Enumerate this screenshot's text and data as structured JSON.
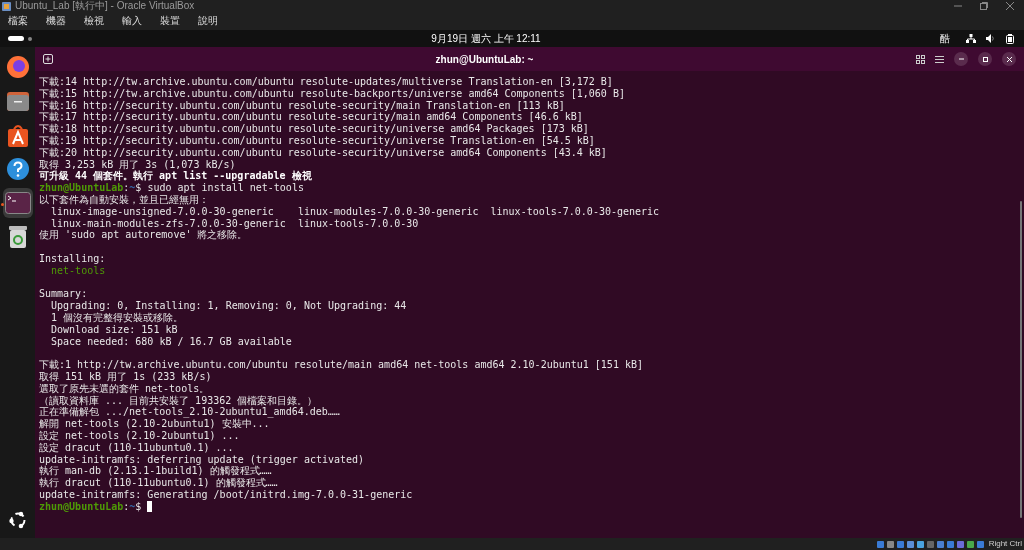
{
  "host_window": {
    "title": "Ubuntu_Lab [執行中] - Oracle VirtualBox"
  },
  "host_menu": [
    "檔案",
    "機器",
    "檢視",
    "輸入",
    "裝置",
    "說明"
  ],
  "top_bar": {
    "clock": "9月19日 週六 上午 12:11",
    "input_method": "酷"
  },
  "dock": {
    "apps": [
      {
        "kind": "browser",
        "selected": false
      },
      {
        "kind": "files",
        "selected": false
      },
      {
        "kind": "store",
        "selected": false
      },
      {
        "kind": "help",
        "selected": false
      },
      {
        "kind": "terminal",
        "selected": true
      },
      {
        "kind": "trash",
        "selected": false
      }
    ]
  },
  "terminal": {
    "title": "zhun@UbuntuLab: ~",
    "lines": [
      {
        "kind": "plain",
        "text": "下載:14 http://tw.archive.ubuntu.com/ubuntu resolute-updates/multiverse Translation-en [3,172 B]"
      },
      {
        "kind": "plain",
        "text": "下載:15 http://tw.archive.ubuntu.com/ubuntu resolute-backports/universe amd64 Components [1,060 B]"
      },
      {
        "kind": "plain",
        "text": "下載:16 http://security.ubuntu.com/ubuntu resolute-security/main Translation-en [113 kB]"
      },
      {
        "kind": "plain",
        "text": "下載:17 http://security.ubuntu.com/ubuntu resolute-security/main amd64 Components [46.6 kB]"
      },
      {
        "kind": "plain",
        "text": "下載:18 http://security.ubuntu.com/ubuntu resolute-security/universe amd64 Packages [173 kB]"
      },
      {
        "kind": "plain",
        "text": "下載:19 http://security.ubuntu.com/ubuntu resolute-security/universe Translation-en [54.5 kB]"
      },
      {
        "kind": "plain",
        "text": "下載:20 http://security.ubuntu.com/ubuntu resolute-security/universe amd64 Components [43.4 kB]"
      },
      {
        "kind": "plain",
        "text": "取得 3,253 kB 用了 3s (1,073 kB/s)"
      },
      {
        "kind": "bold",
        "text": "可升級 44 個套件。執行 apt list --upgradable 檢視"
      },
      {
        "kind": "prompt",
        "user": "zhun@UbuntuLab",
        "colon": ":",
        "path": "~",
        "command": "$ sudo apt install net-tools",
        "cursor": false
      },
      {
        "kind": "plain",
        "text": "以下套件為自動安裝，並且已經無用："
      },
      {
        "kind": "plain",
        "text": "  linux-image-unsigned-7.0.0-30-generic    linux-modules-7.0.0-30-generic  linux-tools-7.0.0-30-generic"
      },
      {
        "kind": "plain",
        "text": "  linux-main-modules-zfs-7.0.0-30-generic  linux-tools-7.0.0-30"
      },
      {
        "kind": "plain",
        "text": "使用 'sudo apt autoremove' 將之移除。"
      },
      {
        "kind": "blank"
      },
      {
        "kind": "plain",
        "text": "Installing:"
      },
      {
        "kind": "package",
        "text": "  net-tools"
      },
      {
        "kind": "blank"
      },
      {
        "kind": "plain",
        "text": "Summary:"
      },
      {
        "kind": "plain",
        "text": "  Upgrading: 0, Installing: 1, Removing: 0, Not Upgrading: 44"
      },
      {
        "kind": "plain",
        "text": "  1 個沒有完整得安裝或移除。"
      },
      {
        "kind": "plain",
        "text": "  Download size: 151 kB"
      },
      {
        "kind": "plain",
        "text": "  Space needed: 680 kB / 16.7 GB available"
      },
      {
        "kind": "blank"
      },
      {
        "kind": "plain",
        "text": "下載:1 http://tw.archive.ubuntu.com/ubuntu resolute/main amd64 net-tools amd64 2.10-2ubuntu1 [151 kB]"
      },
      {
        "kind": "plain",
        "text": "取得 151 kB 用了 1s (233 kB/s)"
      },
      {
        "kind": "plain",
        "text": "選取了原先未選的套件 net-tools。"
      },
      {
        "kind": "plain",
        "text": "（讀取資料庫 ... 目前共安裝了 193362 個檔案和目錄。）"
      },
      {
        "kind": "plain",
        "text": "正在準備解包 .../net-tools_2.10-2ubuntu1_amd64.deb……"
      },
      {
        "kind": "plain",
        "text": "解開 net-tools (2.10-2ubuntu1) 安裝中..."
      },
      {
        "kind": "plain",
        "text": "設定 net-tools (2.10-2ubuntu1) ..."
      },
      {
        "kind": "plain",
        "text": "設定 dracut (110-11ubuntu0.1) ..."
      },
      {
        "kind": "plain",
        "text": "update-initramfs: deferring update (trigger activated)"
      },
      {
        "kind": "plain",
        "text": "執行 man-db (2.13.1-1build1) 的觸發程式……"
      },
      {
        "kind": "plain",
        "text": "執行 dracut (110-11ubuntu0.1) 的觸發程式……"
      },
      {
        "kind": "plain",
        "text": "update-initramfs: Generating /boot/initrd.img-7.0.0-31-generic"
      },
      {
        "kind": "prompt",
        "user": "zhun@UbuntuLab",
        "colon": ":",
        "path": "~",
        "command": "$",
        "cursor": true
      }
    ]
  },
  "status_bar": {
    "host_key": "Right Ctrl"
  }
}
